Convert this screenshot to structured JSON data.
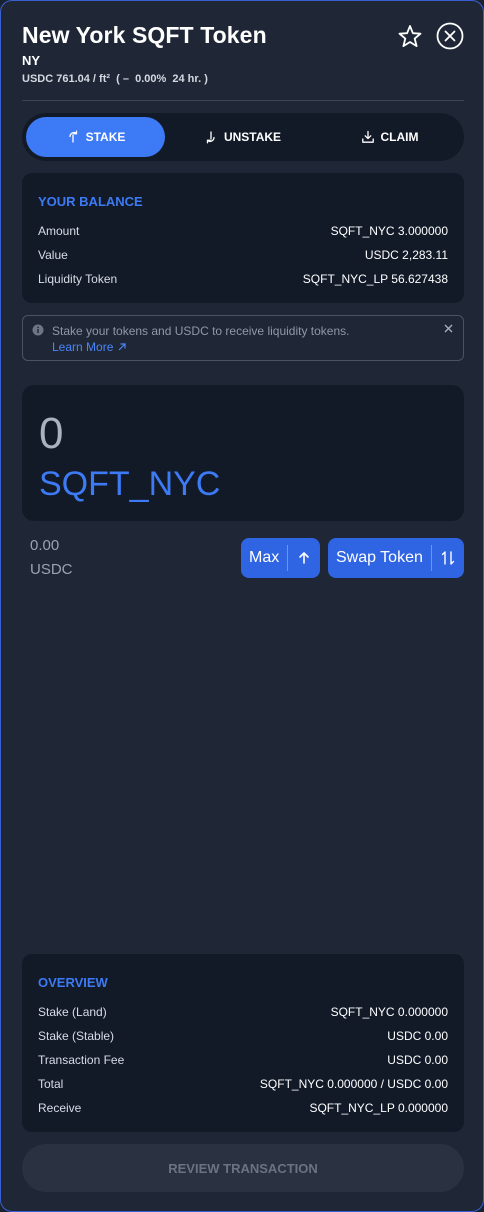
{
  "header": {
    "title": "New York SQFT Token",
    "subtitle": "NY",
    "price": "USDC 761.04 / ft²  ( –  0.00%  24 hr. )"
  },
  "tabs": [
    {
      "label": "STAKE",
      "active": true,
      "icon": "stake-icon"
    },
    {
      "label": "UNSTAKE",
      "active": false,
      "icon": "unstake-icon"
    },
    {
      "label": "CLAIM",
      "active": false,
      "icon": "download-icon"
    }
  ],
  "balance": {
    "heading": "YOUR BALANCE",
    "rows": [
      {
        "label": "Amount",
        "value": "SQFT_NYC 3.000000"
      },
      {
        "label": "Value",
        "value": "USDC 2,283.11"
      },
      {
        "label": "Liquidity Token",
        "value": "SQFT_NYC_LP 56.627438"
      }
    ]
  },
  "info": {
    "text": "Stake your tokens and USDC to receive liquidity tokens.",
    "link": "Learn More"
  },
  "input": {
    "amount": "0",
    "token": "SQFT_NYC",
    "usd_amount": "0.00",
    "usd_unit": "USDC"
  },
  "buttons": {
    "max": "Max",
    "swap": "Swap Token",
    "review": "REVIEW TRANSACTION"
  },
  "overview": {
    "heading": "OVERVIEW",
    "rows": [
      {
        "label": "Stake (Land)",
        "value": "SQFT_NYC 0.000000"
      },
      {
        "label": "Stake (Stable)",
        "value": "USDC 0.00"
      },
      {
        "label": "Transaction Fee",
        "value": "USDC 0.00"
      },
      {
        "label": "Total",
        "value": "SQFT_NYC 0.000000 / USDC 0.00"
      },
      {
        "label": "Receive",
        "value": "SQFT_NYC_LP 0.000000"
      }
    ]
  },
  "colors": {
    "accent": "#3d7af5",
    "panel": "#1f2736",
    "card": "#121a28"
  }
}
